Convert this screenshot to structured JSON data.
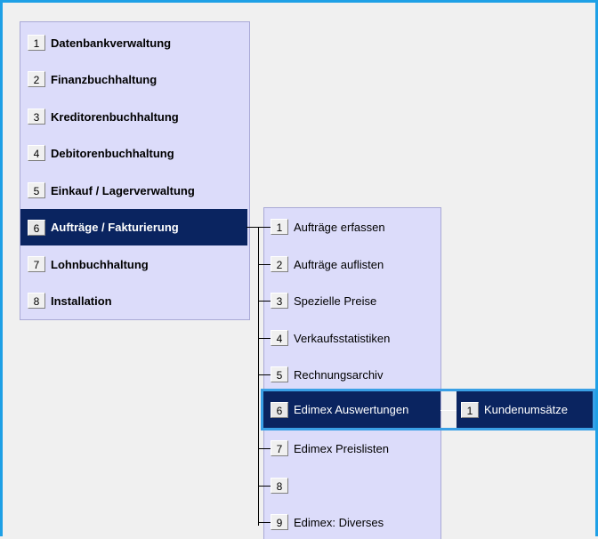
{
  "main_menu": [
    {
      "num": "1",
      "label": "Datenbankverwaltung"
    },
    {
      "num": "2",
      "label": "Finanzbuchhaltung"
    },
    {
      "num": "3",
      "label": "Kreditorenbuchhaltung"
    },
    {
      "num": "4",
      "label": "Debitorenbuchhaltung"
    },
    {
      "num": "5",
      "label": "Einkauf / Lagerverwaltung"
    },
    {
      "num": "6",
      "label": "Aufträge / Fakturierung"
    },
    {
      "num": "7",
      "label": "Lohnbuchhaltung"
    },
    {
      "num": "8",
      "label": "Installation"
    }
  ],
  "sub_menu": [
    {
      "num": "1",
      "label": "Aufträge erfassen"
    },
    {
      "num": "2",
      "label": "Aufträge auflisten"
    },
    {
      "num": "3",
      "label": "Spezielle Preise"
    },
    {
      "num": "4",
      "label": "Verkaufsstatistiken"
    },
    {
      "num": "5",
      "label": "Rechnungsarchiv"
    },
    {
      "num": "6",
      "label": "Edimex Auswertungen"
    },
    {
      "num": "7",
      "label": "Edimex Preislisten"
    },
    {
      "num": "8",
      "label": ""
    },
    {
      "num": "9",
      "label": "Edimex: Diverses"
    }
  ],
  "sub_sub_menu": [
    {
      "num": "1",
      "label": "Kundenumsätze"
    }
  ],
  "colors": {
    "selected": "#0a2460",
    "menu_bg": "#dcdcfa",
    "frame": "#1ea0e6"
  }
}
